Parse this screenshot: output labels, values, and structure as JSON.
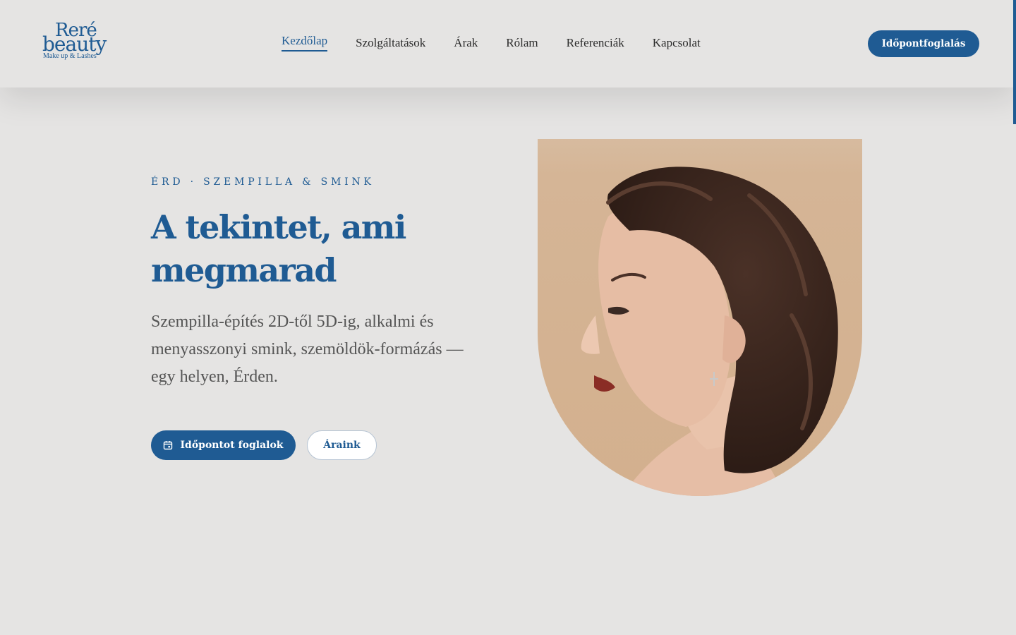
{
  "brand": {
    "logo_line1": "Reré",
    "logo_line2": "beauty",
    "logo_tagline": "Make up & Lashes",
    "accent_color": "#1f5b93",
    "background_color": "#e5e4e3"
  },
  "nav": {
    "items": [
      {
        "label": "Kezdőlap",
        "active": true
      },
      {
        "label": "Szolgáltatások",
        "active": false
      },
      {
        "label": "Árak",
        "active": false
      },
      {
        "label": "Rólam",
        "active": false
      },
      {
        "label": "Referenciák",
        "active": false
      },
      {
        "label": "Kapcsolat",
        "active": false
      }
    ],
    "cta_label": "Időpontfoglalás"
  },
  "hero": {
    "eyebrow": "ÉRD · SZEMPILLA & SMINK",
    "headline": "A tekintet, ami megmarad",
    "lead": "Szempilla-építés 2D-től 5D-ig, alkalmi és menyasszonyi smink, szemöldök-formázás — egy helyen, Érden.",
    "primary_button": "Időpontot foglalok",
    "primary_button_icon": "calendar-icon",
    "secondary_button": "Áraink",
    "image_subject": "woman-profile-portrait"
  }
}
